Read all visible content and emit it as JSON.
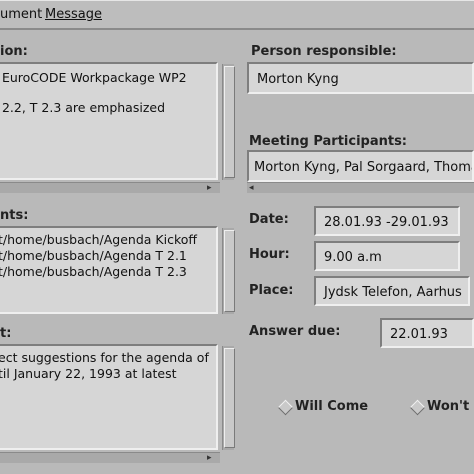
{
  "menu": {
    "items": [
      {
        "label": "ument"
      },
      {
        "label": "Message"
      }
    ]
  },
  "left": {
    "description_label": "ion:",
    "description_lines": [
      " EuroCODE Workpackage WP2",
      "",
      " 2.2, T 2.3 are emphasized"
    ],
    "attachments_label": "nts:",
    "attachments_lines": [
      "t/home/busbach/Agenda Kickoff",
      "t/home/busbach/Agenda T 2.1",
      "t/home/busbach/Agenda T 2.3"
    ],
    "text_label": "t:",
    "text_lines": [
      "ect suggestions for the agenda of",
      "til January 22, 1993 at latest"
    ]
  },
  "right": {
    "person_label": "Person responsible:",
    "person_value": "Morton Kyng",
    "participants_label": "Meeting Participants:",
    "participants_value": "Morton Kyng, Pal Sorgaard, Thomas",
    "date_label": "Date:",
    "date_value": "28.01.93 -29.01.93",
    "hour_label": "Hour:",
    "hour_value": "9.00 a.m",
    "place_label": "Place:",
    "place_value": "Jydsk Telefon, Aarhus",
    "answer_label": "Answer due:",
    "answer_value": "22.01.93",
    "will_come_label": "Will Come",
    "wont_come_label": "Won't C"
  }
}
